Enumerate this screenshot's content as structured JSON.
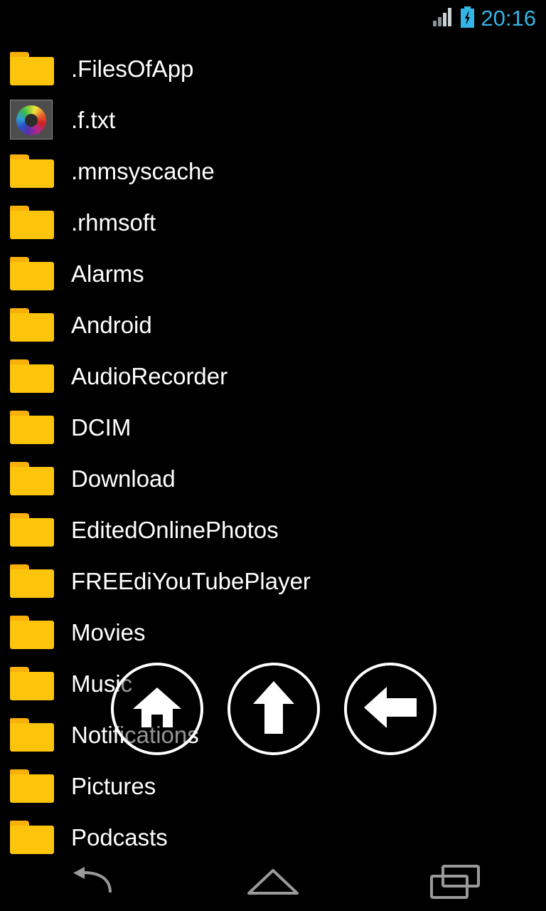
{
  "status_bar": {
    "clock": "20:16",
    "signal_icon": "signal-bars-icon",
    "battery_icon": "battery-charging-icon",
    "accent_color": "#33b5e5"
  },
  "file_list": {
    "rows": [
      {
        "name": ".FilesOfApp",
        "type": "folder"
      },
      {
        "name": ".f.txt",
        "type": "file"
      },
      {
        "name": ".mmsyscache",
        "type": "folder"
      },
      {
        "name": ".rhmsoft",
        "type": "folder"
      },
      {
        "name": "Alarms",
        "type": "folder"
      },
      {
        "name": "Android",
        "type": "folder"
      },
      {
        "name": "AudioRecorder",
        "type": "folder"
      },
      {
        "name": "DCIM",
        "type": "folder"
      },
      {
        "name": "Download",
        "type": "folder"
      },
      {
        "name": "EditedOnlinePhotos",
        "type": "folder"
      },
      {
        "name": "FREEdiYouTubePlayer",
        "type": "folder"
      },
      {
        "name": "Movies",
        "type": "folder"
      },
      {
        "name": "Music",
        "type": "folder"
      },
      {
        "name": "Notifications",
        "type": "folder"
      },
      {
        "name": "Pictures",
        "type": "folder"
      },
      {
        "name": "Podcasts",
        "type": "folder"
      }
    ],
    "folder_color": "#fcc40b",
    "text_color": "#ffffff"
  },
  "float_nav": {
    "buttons": [
      {
        "icon": "home-icon",
        "label": "Home"
      },
      {
        "icon": "arrow-up-icon",
        "label": "Up"
      },
      {
        "icon": "arrow-left-icon",
        "label": "Back"
      }
    ]
  },
  "system_nav": {
    "buttons": [
      {
        "icon": "back-icon",
        "label": "Back"
      },
      {
        "icon": "home-outline-icon",
        "label": "Home"
      },
      {
        "icon": "recents-icon",
        "label": "Recents"
      }
    ]
  }
}
